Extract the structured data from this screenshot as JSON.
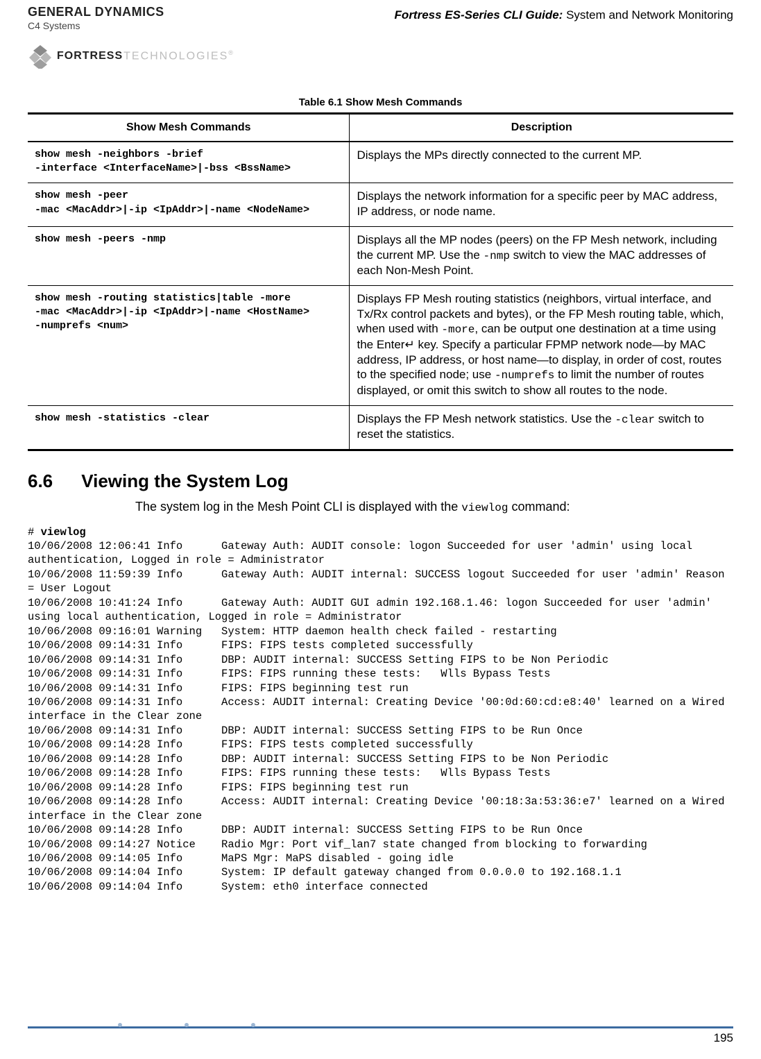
{
  "header": {
    "company_line1": "GENERAL DYNAMICS",
    "company_line2": "C4 Systems",
    "brand_black": "FORTRESS",
    "brand_grey": "TECHNOLOGIES",
    "brand_reg": "®",
    "guide_em": "Fortress ES-Series CLI Guide:",
    "guide_rest": " System and Network Monitoring"
  },
  "table": {
    "caption": "Table 6.1 Show Mesh Commands",
    "columns": [
      "Show Mesh Commands",
      "Description"
    ],
    "rows": [
      {
        "cmd": "show mesh -neighbors -brief\n-interface <InterfaceName>|-bss <BssName>",
        "desc": "Displays the MPs directly connected to the current MP."
      },
      {
        "cmd": "show mesh -peer\n-mac <MacAddr>|-ip <IpAddr>|-name <NodeName>",
        "desc": "Displays the network information for a specific peer by MAC address, IP address, or node name."
      },
      {
        "cmd": "show mesh -peers -nmp",
        "desc_pre": "Displays all the MP nodes (peers) on the FP Mesh network, including the current MP. Use the ",
        "mono1": "-nmp",
        "desc_post": " switch to view the MAC addresses of each Non-Mesh Point."
      },
      {
        "cmd": "show mesh -routing statistics|table -more\n-mac <MacAddr>|-ip <IpAddr>|-name <HostName>\n-numprefs <num>",
        "desc_p1": "Displays FP Mesh routing statistics (neighbors, virtual interface, and Tx/Rx control packets and bytes), or the FP Mesh routing table, which, when used with ",
        "mono1": "-more",
        "desc_p2": ", can be output one destination at a time using the ",
        "enter": "Enter↵",
        "desc_p3": " key. Specify a particular FPMP network node—by MAC address, IP address, or host name—to display, in order of cost, routes to the specified node; use ",
        "mono2": "-numprefs",
        "desc_p4": " to limit the number of routes displayed, or omit this switch to show all routes to the node."
      },
      {
        "cmd": "show mesh -statistics -clear",
        "desc_pre": "Displays the FP Mesh network statistics. Use the ",
        "mono1": "-clear",
        "desc_post": " switch to reset the statistics."
      }
    ]
  },
  "section": {
    "num": "6.6",
    "title": "Viewing the System Log",
    "para_pre": "The system log in the Mesh Point CLI is displayed with the ",
    "para_mono": "viewlog",
    "para_post": " command:"
  },
  "log": {
    "prompt": "# ",
    "cmd": "viewlog",
    "body": "10/06/2008 12:06:41 Info      Gateway Auth: AUDIT console: logon Succeeded for user 'admin' using local authentication, Logged in role = Administrator\n10/06/2008 11:59:39 Info      Gateway Auth: AUDIT internal: SUCCESS logout Succeeded for user 'admin' Reason = User Logout\n10/06/2008 10:41:24 Info      Gateway Auth: AUDIT GUI admin 192.168.1.46: logon Succeeded for user 'admin' using local authentication, Logged in role = Administrator\n10/06/2008 09:16:01 Warning   System: HTTP daemon health check failed - restarting\n10/06/2008 09:14:31 Info      FIPS: FIPS tests completed successfully\n10/06/2008 09:14:31 Info      DBP: AUDIT internal: SUCCESS Setting FIPS to be Non Periodic\n10/06/2008 09:14:31 Info      FIPS: FIPS running these tests:   Wlls Bypass Tests\n10/06/2008 09:14:31 Info      FIPS: FIPS beginning test run\n10/06/2008 09:14:31 Info      Access: AUDIT internal: Creating Device '00:0d:60:cd:e8:40' learned on a Wired interface in the Clear zone\n10/06/2008 09:14:31 Info      DBP: AUDIT internal: SUCCESS Setting FIPS to be Run Once\n10/06/2008 09:14:28 Info      FIPS: FIPS tests completed successfully\n10/06/2008 09:14:28 Info      DBP: AUDIT internal: SUCCESS Setting FIPS to be Non Periodic\n10/06/2008 09:14:28 Info      FIPS: FIPS running these tests:   Wlls Bypass Tests\n10/06/2008 09:14:28 Info      FIPS: FIPS beginning test run\n10/06/2008 09:14:28 Info      Access: AUDIT internal: Creating Device '00:18:3a:53:36:e7' learned on a Wired interface in the Clear zone\n10/06/2008 09:14:28 Info      DBP: AUDIT internal: SUCCESS Setting FIPS to be Run Once\n10/06/2008 09:14:27 Notice    Radio Mgr: Port vif_lan7 state changed from blocking to forwarding\n10/06/2008 09:14:05 Info      MaPS Mgr: MaPS disabled - going idle\n10/06/2008 09:14:04 Info      System: IP default gateway changed from 0.0.0.0 to 192.168.1.1\n10/06/2008 09:14:04 Info      System: eth0 interface connected"
  },
  "footer": {
    "page": "195"
  }
}
